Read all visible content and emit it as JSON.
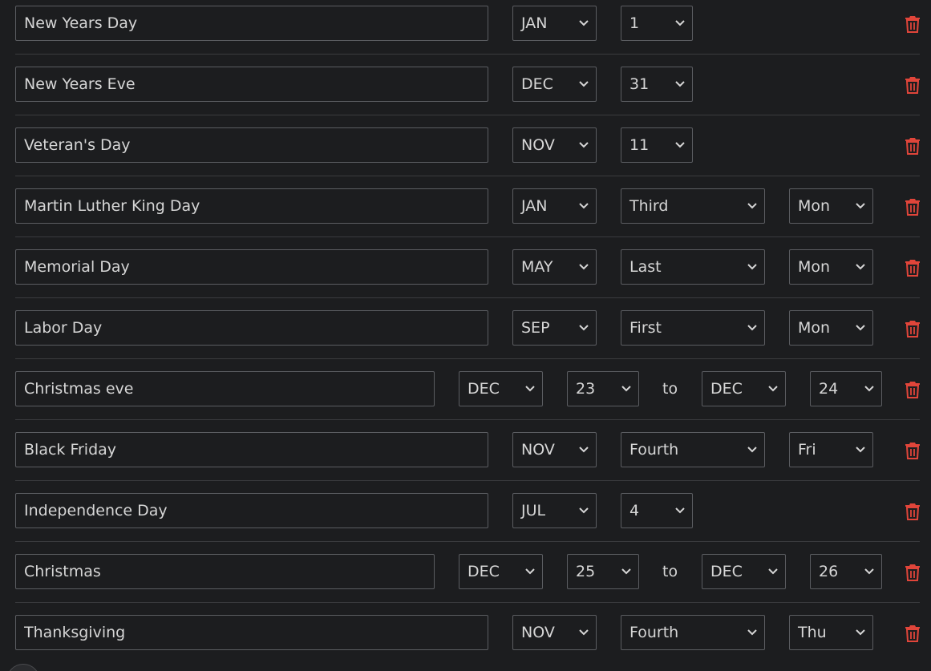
{
  "colors": {
    "background": "#1c1d1f",
    "border": "#5b5d61",
    "text": "#d6d6d6",
    "divider": "#3a3b3e",
    "delete": "#e0453a"
  },
  "icons": {
    "delete": "trash-icon",
    "dropdown": "chevron-down-icon"
  },
  "holidays": [
    {
      "name": "New Years Day",
      "month": "JAN",
      "day": "1"
    },
    {
      "name": "New Years Eve",
      "month": "DEC",
      "day": "31"
    },
    {
      "name": "Veteran's Day",
      "month": "NOV",
      "day": "11"
    },
    {
      "name": "Martin Luther King Day",
      "month": "JAN",
      "week": "Third",
      "weekday": "Mon"
    },
    {
      "name": "Memorial Day",
      "month": "MAY",
      "week": "Last",
      "weekday": "Mon"
    },
    {
      "name": "Labor Day",
      "month": "SEP",
      "week": "First",
      "weekday": "Mon"
    },
    {
      "name": "Christmas eve",
      "start_month": "DEC",
      "start_day": "23",
      "separator": "to",
      "end_month": "DEC",
      "end_day": "24"
    },
    {
      "name": "Black Friday",
      "month": "NOV",
      "week": "Fourth",
      "weekday": "Fri"
    },
    {
      "name": "Independence Day",
      "month": "JUL",
      "day": "4"
    },
    {
      "name": "Christmas",
      "start_month": "DEC",
      "start_day": "25",
      "separator": "to",
      "end_month": "DEC",
      "end_day": "26"
    },
    {
      "name": "Thanksgiving",
      "month": "NOV",
      "week": "Fourth",
      "weekday": "Thu"
    }
  ]
}
